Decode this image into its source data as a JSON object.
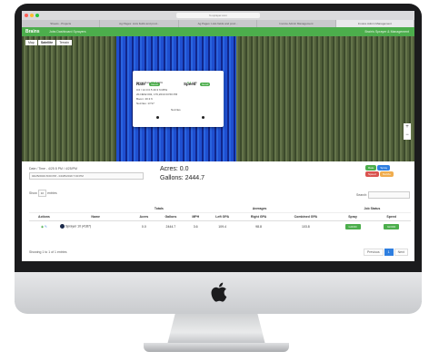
{
  "browser": {
    "url": "fs.sprayer.com",
    "tabs": [
      "Sheets - Projects",
      "Ag Pages: Lists fields and prod...",
      "Ag Pages: Lists fields and prod...",
      "Invoice Admin Management",
      "Invoice Admin Management"
    ]
  },
  "app": {
    "brand": "Brains",
    "nav": "Jobs  Dashboard  Sprayers",
    "user": "Brain's Sprayer & Management"
  },
  "map": {
    "tabs": [
      "Map",
      "Satellite",
      "Terrain"
    ],
    "zoom_in": "+",
    "zoom_out": "−",
    "popup": {
      "rate_label": "Rate",
      "rate_badge": "Good",
      "speed_label": "Speed",
      "speed_badge": "Good",
      "target_rate_label": "Target Rate",
      "target_rate_value": "50.2",
      "target_rate_unit": "GPA",
      "actual_rate": "3.1",
      "actual_rate_unit": "mph",
      "line1": "0.0 / 12.0 0.5 40.3 ft MPH",
      "line2": "20-NEW-002, 176,2019 03:50 PM",
      "line3": "Boom: 40.3 ft",
      "line4": "Nozzles: 17/17",
      "gauge_label": "Nozzles"
    }
  },
  "panel": {
    "datetime_label": "Date / Time - 4/25 8 PM / 4/25/PM",
    "datetime_value": "04/25/2019 8:00 PM - 04/25/2019 7:00 PM",
    "acres_label": "Acres: 0.0",
    "gallons_label": "Gallons: 2444.7",
    "show_label": "Show",
    "show_value": "10",
    "entries_label": "entries",
    "search_label": "Search:",
    "search_placeholder": "",
    "buttons": [
      "Rate",
      "Spray",
      "Speed",
      "Nozzle"
    ],
    "colors": {
      "green": "#4cae4c",
      "blue": "#2f7fe0",
      "red": "#d9534f",
      "orange": "#f0ad4e"
    },
    "group_headers": {
      "totals": "Totals",
      "averages": "Averages",
      "job_status": "Job Status"
    },
    "columns": [
      "Actions",
      "Name",
      "Acres",
      "Gallons",
      "MPH",
      "Left GPA",
      "Right GPA",
      "Combined GPA",
      "Spray",
      "Speed"
    ],
    "rows": [
      {
        "name": "Sprayer 10 (4187)",
        "acres": "0.0",
        "gallons": "2444.7",
        "mph": "3.6",
        "left_gpa": "109.4",
        "right_gpa": "98.8",
        "combined_gpa": "103.8",
        "spray": "GOOD",
        "speed": "GOOD"
      }
    ],
    "footer_info": "Showing 1 to 1 of 1 entries",
    "pagination": {
      "prev": "Previous",
      "page": "1",
      "next": "Next"
    }
  }
}
